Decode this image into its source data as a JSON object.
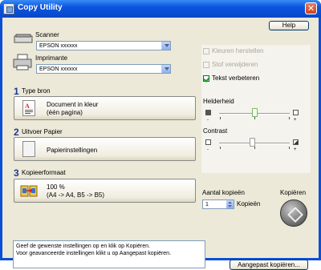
{
  "window": {
    "title": "Copy Utility"
  },
  "toolbar": {
    "help_label": "Help"
  },
  "scanner": {
    "label": "Scanner",
    "value": "EPSON xxxxxx"
  },
  "printer": {
    "label": "Imprimante",
    "value": "EPSON xxxxxx"
  },
  "sections": [
    {
      "number": "1",
      "title": "Type bron",
      "line1": "Document in kleur",
      "line2": "(één pagina)"
    },
    {
      "number": "2",
      "title": "Uitvoer Papier",
      "line1": "Papierinstellingen",
      "line2": ""
    },
    {
      "number": "3",
      "title": "Kopieerformaat",
      "line1": "100 %",
      "line2": "(A4 -> A4, B5 -> B5)"
    }
  ],
  "options": {
    "restore_colors": {
      "label": "Kleuren herstellen",
      "checked": false,
      "enabled": false
    },
    "remove_dust": {
      "label": "Stof verwijderen",
      "checked": false,
      "enabled": false
    },
    "enhance_text": {
      "label": "Tekst verbeteren",
      "checked": true,
      "enabled": true
    }
  },
  "brightness": {
    "label": "Helderheid",
    "minus": "-",
    "plus": "+",
    "level": 0.5
  },
  "contrast": {
    "label": "Contrast",
    "minus": "-",
    "plus": "+",
    "level": 0.5
  },
  "copies": {
    "label": "Aantal kopieën",
    "value": "1",
    "unit": "Kopieën"
  },
  "copy_action": {
    "label": "Kopiëren"
  },
  "message": {
    "line1": "Geef de gewenste instellingen op en klik op Kopiëren.",
    "line2": "Voor geavanceerde instellingen klikt u op Aangepast kopiëren."
  },
  "custom_copy": {
    "label": "Aangepast kopiëren..."
  },
  "colors": {
    "titlebar": "#0b55e0",
    "face": "#ece9d8",
    "section_number": "#1b3a8c",
    "checkmark": "#21a121"
  }
}
